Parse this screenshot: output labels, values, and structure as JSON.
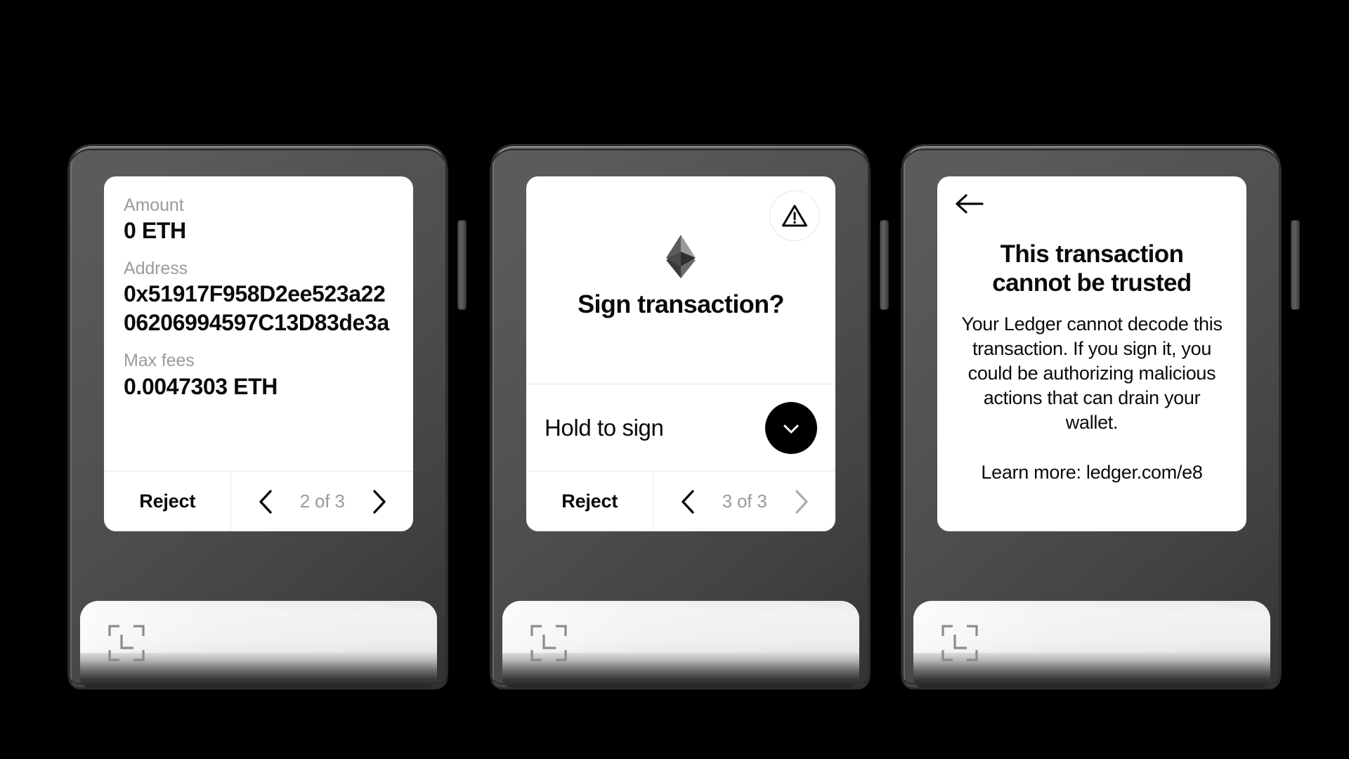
{
  "brand": {
    "logo_name": "ledger-logo",
    "accent": "#000000",
    "muted": "#9b9b9b"
  },
  "devices": [
    {
      "id": "device-1",
      "screen": "transaction-details",
      "fields": [
        {
          "label": "Amount",
          "value": "0 ETH"
        },
        {
          "label": "Address",
          "value": "0x51917F958D2ee523a2206206994597C13D83de3a"
        },
        {
          "label": "Max fees",
          "value": "0.0047303 ETH"
        }
      ],
      "actions": {
        "reject_label": "Reject",
        "page_label": "2 of 3",
        "prev_enabled": true,
        "next_enabled": true
      }
    },
    {
      "id": "device-2",
      "screen": "sign-confirmation",
      "warning_icon": "warning-triangle-icon",
      "coin_icon": "ethereum-logo-icon",
      "title": "Sign transaction?",
      "hold": {
        "label": "Hold to sign",
        "button_icon": "check-icon"
      },
      "actions": {
        "reject_label": "Reject",
        "page_label": "3 of 3",
        "prev_enabled": true,
        "next_enabled": false
      }
    },
    {
      "id": "device-3",
      "screen": "untrusted-warning",
      "back_icon": "arrow-left-icon",
      "title": "This transaction cannot be trusted",
      "body": "Your Ledger cannot decode this transaction. If you sign it, you could be authorizing malicious actions that can drain your wallet.",
      "learn_more": "Learn more: ledger.com/e8"
    }
  ]
}
